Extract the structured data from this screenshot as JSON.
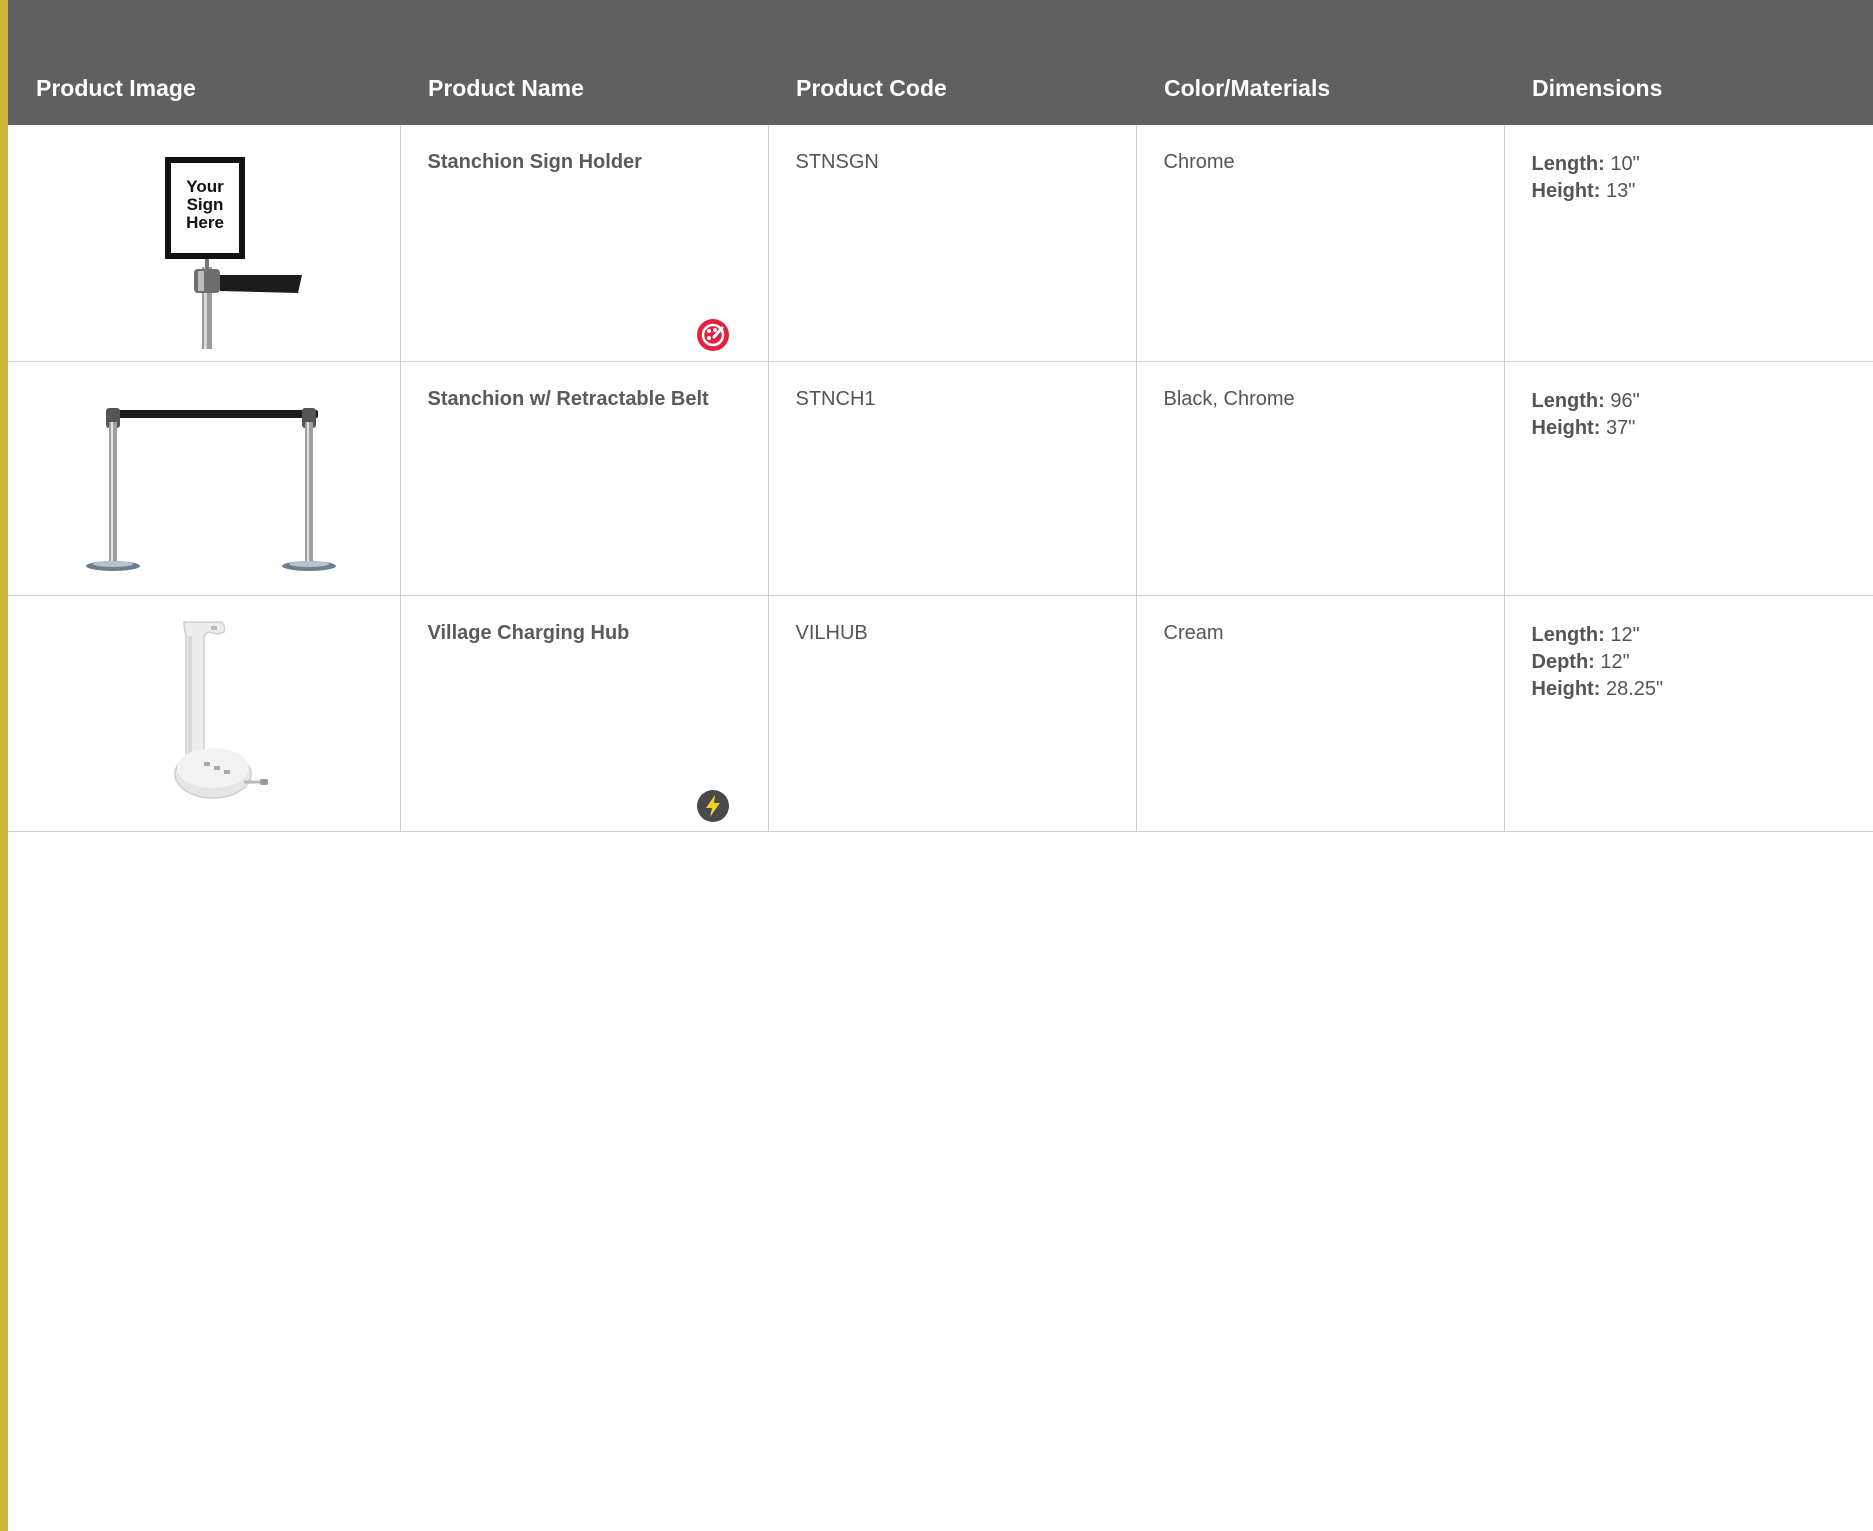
{
  "table": {
    "headers": [
      "Product Image",
      "Product Name",
      "Product Code",
      "Color/Materials",
      "Dimensions"
    ],
    "rows": [
      {
        "image_icon": "stanchion-sign-holder-image",
        "sign_text": [
          "Your",
          "Sign",
          "Here"
        ],
        "name": "Stanchion Sign Holder",
        "code": "STNSGN",
        "materials": "Chrome",
        "badge_icon": "palette-icon",
        "dimensions": [
          {
            "label": "Length:",
            "value": "10\""
          },
          {
            "label": "Height:",
            "value": "13\""
          }
        ]
      },
      {
        "image_icon": "stanchion-retractable-belt-image",
        "name": "Stanchion w/ Retractable Belt",
        "code": "STNCH1",
        "materials": "Black, Chrome",
        "dimensions": [
          {
            "label": "Length:",
            "value": "96\""
          },
          {
            "label": "Height:",
            "value": "37\""
          }
        ]
      },
      {
        "image_icon": "charging-hub-image",
        "name": "Village Charging Hub",
        "code": "VILHUB",
        "materials": "Cream",
        "badge_icon": "lightning-bolt-icon",
        "dimensions": [
          {
            "label": "Length:",
            "value": "12\""
          },
          {
            "label": "Depth:",
            "value": "12\""
          },
          {
            "label": "Height:",
            "value": "28.25\""
          }
        ]
      }
    ]
  },
  "colors": {
    "header_bg": "#606060",
    "accent": "#cdb735",
    "palette_badge": "#e0213f",
    "power_badge": "#4a4a4a"
  }
}
